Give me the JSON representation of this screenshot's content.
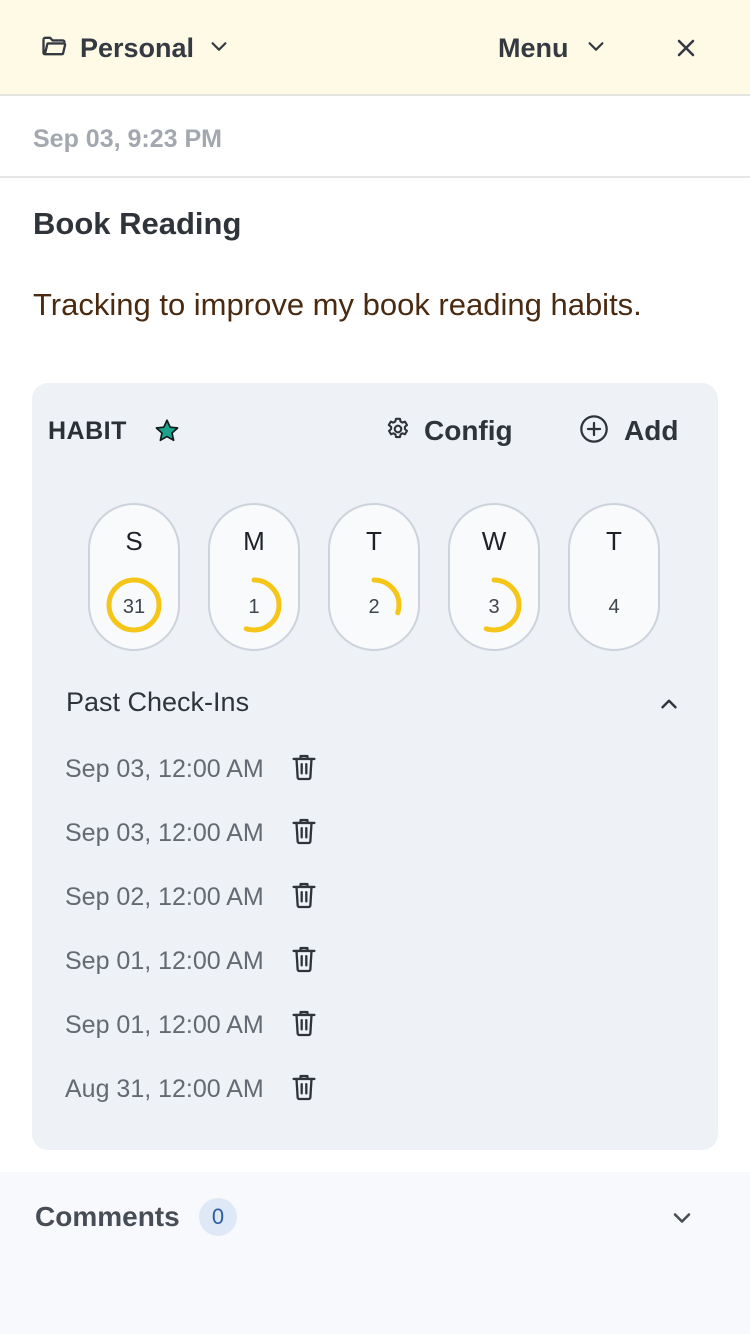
{
  "header": {
    "folder_label": "Personal",
    "menu_label": "Menu",
    "icons": {
      "folder": "folder-icon",
      "chevron": "chevron-down-icon",
      "close": "close-icon"
    }
  },
  "note": {
    "date": "Sep 03, 9:23 PM",
    "title": "Book Reading",
    "description": "Tracking to improve my book reading habits."
  },
  "habit": {
    "label": "HABIT",
    "config_label": "Config",
    "add_label": "Add",
    "star_color": "#1aa38c",
    "progress_color": "#f5c518",
    "days": [
      {
        "letter": "S",
        "date": "31",
        "progress": 1.0
      },
      {
        "letter": "M",
        "date": "1",
        "progress": 0.55
      },
      {
        "letter": "T",
        "date": "2",
        "progress": 0.3
      },
      {
        "letter": "W",
        "date": "3",
        "progress": 0.55
      },
      {
        "letter": "T",
        "date": "4",
        "progress": 0
      }
    ],
    "past_checkins_label": "Past Check-Ins",
    "checkins": [
      "Sep 03, 12:00 AM",
      "Sep 03, 12:00 AM",
      "Sep 02, 12:00 AM",
      "Sep 01, 12:00 AM",
      "Sep 01, 12:00 AM",
      "Aug 31, 12:00 AM"
    ]
  },
  "comments": {
    "label": "Comments",
    "count": "0"
  }
}
